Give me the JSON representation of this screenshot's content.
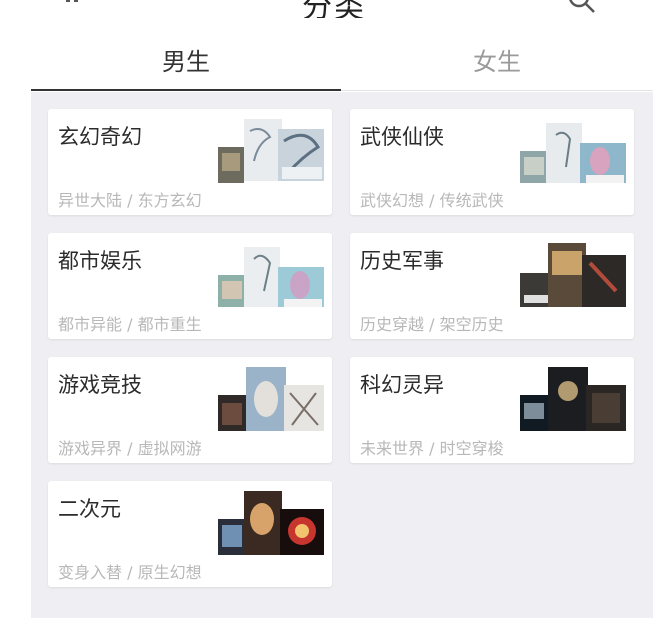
{
  "header": {
    "title": "分类",
    "left_icon": "category-grid-icon",
    "right_icon": "search-icon"
  },
  "tabs": [
    {
      "label": "男生",
      "active": true
    },
    {
      "label": "女生",
      "active": false
    }
  ],
  "categories": [
    {
      "title": "玄幻奇幻",
      "subtitle": "异世大陆 / 东方玄幻"
    },
    {
      "title": "武侠仙侠",
      "subtitle": "武侠幻想 / 传统武侠"
    },
    {
      "title": "都市娱乐",
      "subtitle": "都市异能 / 都市重生"
    },
    {
      "title": "历史军事",
      "subtitle": "历史穿越 / 架空历史"
    },
    {
      "title": "游戏竞技",
      "subtitle": "游戏异界 / 虚拟网游"
    },
    {
      "title": "科幻灵异",
      "subtitle": "未来世界 / 时空穿梭"
    },
    {
      "title": "二次元",
      "subtitle": "变身入替 / 原生幻想"
    }
  ],
  "colors": {
    "page_background": "#efeff3",
    "active_tab": "#333333",
    "inactive_tab": "#9a9a9a",
    "subtitle": "#b8b8b8"
  }
}
